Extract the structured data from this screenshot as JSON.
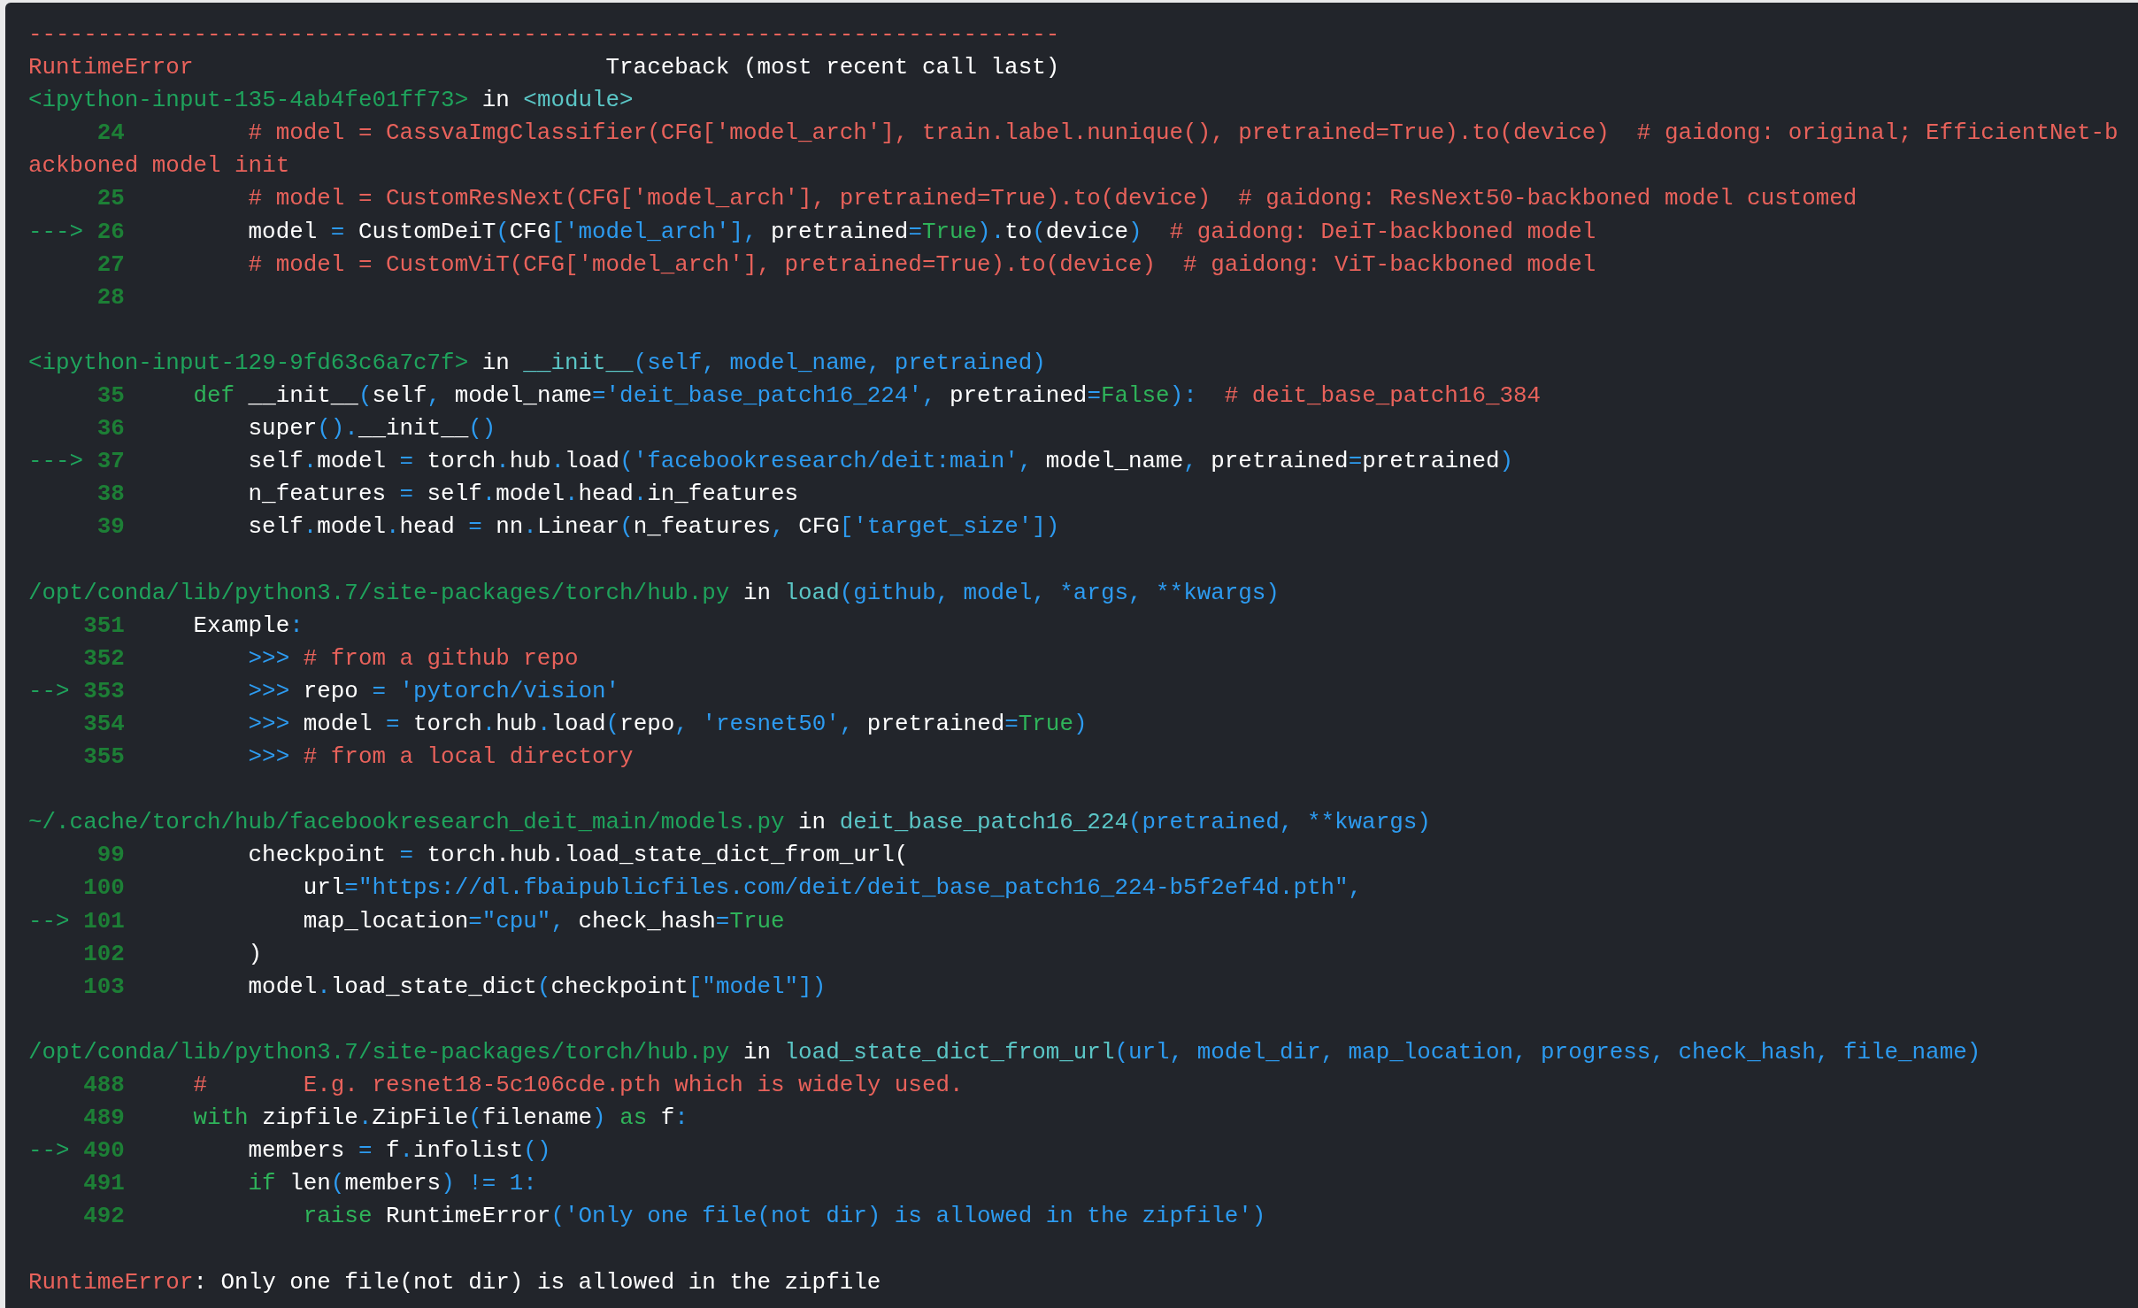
{
  "separator": "---------------------------------------------------------------------------",
  "error_type": "RuntimeError",
  "traceback_title": "Traceback (most recent call last)",
  "frames": [
    {
      "header": [
        {
          "kind": "path",
          "text": "<ipython-input-135-4ab4fe01ff73>"
        },
        {
          "kind": "plain",
          "text": " in "
        },
        {
          "kind": "func",
          "text": "<module>"
        }
      ],
      "lines": [
        {
          "number": "24",
          "code": [
            {
              "kind": "comment",
              "text": "         # model = CassvaImgClassifier(CFG['model_arch'], train.label.nunique(), pretrained=True).to(device)  # gaidong: original; EfficientNet-backboned model init"
            }
          ]
        },
        {
          "number": "25",
          "code": [
            {
              "kind": "comment",
              "text": "         # model = CustomResNext(CFG['model_arch'], pretrained=True).to(device)  # gaidong: ResNext50-backboned model customed"
            }
          ]
        },
        {
          "arrow": "--->",
          "number": "26",
          "code": [
            {
              "kind": "plain",
              "text": "         model "
            },
            {
              "kind": "op",
              "text": "= "
            },
            {
              "kind": "plain",
              "text": "CustomDeiT"
            },
            {
              "kind": "op",
              "text": "("
            },
            {
              "kind": "plain",
              "text": "CFG"
            },
            {
              "kind": "op",
              "text": "['model_arch'], "
            },
            {
              "kind": "plain",
              "text": "pretrained"
            },
            {
              "kind": "op",
              "text": "="
            },
            {
              "kind": "keyword",
              "text": "True"
            },
            {
              "kind": "op",
              "text": ")."
            },
            {
              "kind": "plain",
              "text": "to"
            },
            {
              "kind": "op",
              "text": "("
            },
            {
              "kind": "plain",
              "text": "device"
            },
            {
              "kind": "op",
              "text": ")"
            },
            {
              "kind": "comment",
              "text": "  # gaidong: DeiT-backboned model"
            }
          ]
        },
        {
          "number": "27",
          "code": [
            {
              "kind": "comment",
              "text": "         # model = CustomViT(CFG['model_arch'], pretrained=True).to(device)  # gaidong: ViT-backboned model"
            }
          ]
        },
        {
          "number": "28"
        }
      ]
    },
    {
      "header": [
        {
          "kind": "path",
          "text": "<ipython-input-129-9fd63c6a7c7f>"
        },
        {
          "kind": "plain",
          "text": " in "
        },
        {
          "kind": "func",
          "text": "__init__"
        },
        {
          "kind": "op",
          "text": "(self, model_name, pretrained)"
        }
      ],
      "lines": [
        {
          "number": "35",
          "code": [
            {
              "kind": "keyword",
              "text": "     def "
            },
            {
              "kind": "plain",
              "text": "__init__"
            },
            {
              "kind": "op",
              "text": "("
            },
            {
              "kind": "plain",
              "text": "self"
            },
            {
              "kind": "op",
              "text": ", "
            },
            {
              "kind": "plain",
              "text": "model_name"
            },
            {
              "kind": "op",
              "text": "='deit_base_patch16_224', "
            },
            {
              "kind": "plain",
              "text": "pretrained"
            },
            {
              "kind": "op",
              "text": "="
            },
            {
              "kind": "keyword",
              "text": "False"
            },
            {
              "kind": "op",
              "text": "):"
            },
            {
              "kind": "comment",
              "text": "  # deit_base_patch16_384"
            }
          ]
        },
        {
          "number": "36",
          "code": [
            {
              "kind": "plain",
              "text": "         super"
            },
            {
              "kind": "op",
              "text": "()."
            },
            {
              "kind": "plain",
              "text": "__init__"
            },
            {
              "kind": "op",
              "text": "()"
            }
          ]
        },
        {
          "arrow": "--->",
          "number": "37",
          "code": [
            {
              "kind": "plain",
              "text": "         self"
            },
            {
              "kind": "op",
              "text": "."
            },
            {
              "kind": "plain",
              "text": "model "
            },
            {
              "kind": "op",
              "text": "= "
            },
            {
              "kind": "plain",
              "text": "torch"
            },
            {
              "kind": "op",
              "text": "."
            },
            {
              "kind": "plain",
              "text": "hub"
            },
            {
              "kind": "op",
              "text": "."
            },
            {
              "kind": "plain",
              "text": "load"
            },
            {
              "kind": "op",
              "text": "('facebookresearch/deit:main', "
            },
            {
              "kind": "plain",
              "text": "model_name"
            },
            {
              "kind": "op",
              "text": ", "
            },
            {
              "kind": "plain",
              "text": "pretrained"
            },
            {
              "kind": "op",
              "text": "="
            },
            {
              "kind": "plain",
              "text": "pretrained"
            },
            {
              "kind": "op",
              "text": ")"
            }
          ]
        },
        {
          "number": "38",
          "code": [
            {
              "kind": "plain",
              "text": "         n_features "
            },
            {
              "kind": "op",
              "text": "= "
            },
            {
              "kind": "plain",
              "text": "self"
            },
            {
              "kind": "op",
              "text": "."
            },
            {
              "kind": "plain",
              "text": "model"
            },
            {
              "kind": "op",
              "text": "."
            },
            {
              "kind": "plain",
              "text": "head"
            },
            {
              "kind": "op",
              "text": "."
            },
            {
              "kind": "plain",
              "text": "in_features"
            }
          ]
        },
        {
          "number": "39",
          "code": [
            {
              "kind": "plain",
              "text": "         self"
            },
            {
              "kind": "op",
              "text": "."
            },
            {
              "kind": "plain",
              "text": "model"
            },
            {
              "kind": "op",
              "text": "."
            },
            {
              "kind": "plain",
              "text": "head "
            },
            {
              "kind": "op",
              "text": "= "
            },
            {
              "kind": "plain",
              "text": "nn"
            },
            {
              "kind": "op",
              "text": "."
            },
            {
              "kind": "plain",
              "text": "Linear"
            },
            {
              "kind": "op",
              "text": "("
            },
            {
              "kind": "plain",
              "text": "n_features"
            },
            {
              "kind": "op",
              "text": ", "
            },
            {
              "kind": "plain",
              "text": "CFG"
            },
            {
              "kind": "op",
              "text": "['target_size'])"
            }
          ]
        }
      ]
    },
    {
      "header": [
        {
          "kind": "path",
          "text": "/opt/conda/lib/python3.7/site-packages/torch/hub.py"
        },
        {
          "kind": "plain",
          "text": " in "
        },
        {
          "kind": "func",
          "text": "load"
        },
        {
          "kind": "op",
          "text": "(github, model, *args, **kwargs)"
        }
      ],
      "lines": [
        {
          "number": "351",
          "code": [
            {
              "kind": "plain",
              "text": "     Example"
            },
            {
              "kind": "op",
              "text": ":"
            }
          ]
        },
        {
          "number": "352",
          "code": [
            {
              "kind": "op",
              "text": "         >>> "
            },
            {
              "kind": "comment",
              "text": "# from a github repo"
            }
          ]
        },
        {
          "arrow": "-->",
          "number": "353",
          "code": [
            {
              "kind": "op",
              "text": "         >>> "
            },
            {
              "kind": "plain",
              "text": "repo "
            },
            {
              "kind": "op",
              "text": "= 'pytorch/vision'"
            }
          ]
        },
        {
          "number": "354",
          "code": [
            {
              "kind": "op",
              "text": "         >>> "
            },
            {
              "kind": "plain",
              "text": "model "
            },
            {
              "kind": "op",
              "text": "= "
            },
            {
              "kind": "plain",
              "text": "torch"
            },
            {
              "kind": "op",
              "text": "."
            },
            {
              "kind": "plain",
              "text": "hub"
            },
            {
              "kind": "op",
              "text": "."
            },
            {
              "kind": "plain",
              "text": "load"
            },
            {
              "kind": "op",
              "text": "("
            },
            {
              "kind": "plain",
              "text": "repo"
            },
            {
              "kind": "op",
              "text": ", 'resnet50', "
            },
            {
              "kind": "plain",
              "text": "pretrained"
            },
            {
              "kind": "op",
              "text": "="
            },
            {
              "kind": "keyword",
              "text": "True"
            },
            {
              "kind": "op",
              "text": ")"
            }
          ]
        },
        {
          "number": "355",
          "code": [
            {
              "kind": "op",
              "text": "         >>> "
            },
            {
              "kind": "comment",
              "text": "# from a local directory"
            }
          ]
        }
      ]
    },
    {
      "header": [
        {
          "kind": "path",
          "text": "~/.cache/torch/hub/facebookresearch_deit_main/models.py"
        },
        {
          "kind": "plain",
          "text": " in "
        },
        {
          "kind": "func",
          "text": "deit_base_patch16_224"
        },
        {
          "kind": "op",
          "text": "(pretrained, **kwargs)"
        }
      ],
      "lines": [
        {
          "number": "99",
          "code": [
            {
              "kind": "plain",
              "text": "         checkpoint "
            },
            {
              "kind": "op",
              "text": "= "
            },
            {
              "kind": "plain",
              "text": "torch.hub.load_state_dict_from_url("
            }
          ]
        },
        {
          "number": "100",
          "code": [
            {
              "kind": "plain",
              "text": "             url"
            },
            {
              "kind": "op",
              "text": "=\"https://dl.fbaipublicfiles.com/deit/deit_base_patch16_224-b5f2ef4d.pth\","
            }
          ]
        },
        {
          "arrow": "-->",
          "number": "101",
          "code": [
            {
              "kind": "plain",
              "text": "             map_location"
            },
            {
              "kind": "op",
              "text": "=\"cpu\", "
            },
            {
              "kind": "plain",
              "text": "check_hash"
            },
            {
              "kind": "op",
              "text": "="
            },
            {
              "kind": "keyword",
              "text": "True"
            }
          ]
        },
        {
          "number": "102",
          "code": [
            {
              "kind": "plain",
              "text": "         )"
            }
          ]
        },
        {
          "number": "103",
          "code": [
            {
              "kind": "plain",
              "text": "         model"
            },
            {
              "kind": "op",
              "text": "."
            },
            {
              "kind": "plain",
              "text": "load_state_dict"
            },
            {
              "kind": "op",
              "text": "("
            },
            {
              "kind": "plain",
              "text": "checkpoint"
            },
            {
              "kind": "op",
              "text": "[\"model\"])"
            }
          ]
        }
      ]
    },
    {
      "header": [
        {
          "kind": "path",
          "text": "/opt/conda/lib/python3.7/site-packages/torch/hub.py"
        },
        {
          "kind": "plain",
          "text": " in "
        },
        {
          "kind": "func",
          "text": "load_state_dict_from_url"
        },
        {
          "kind": "op",
          "text": "(url, model_dir, map_location, progress, check_hash, file_name)"
        }
      ],
      "lines": [
        {
          "number": "488",
          "code": [
            {
              "kind": "comment",
              "text": "     #       E.g. resnet18-5c106cde.pth which is widely used."
            }
          ]
        },
        {
          "number": "489",
          "code": [
            {
              "kind": "keyword",
              "text": "     with "
            },
            {
              "kind": "plain",
              "text": "zipfile"
            },
            {
              "kind": "op",
              "text": "."
            },
            {
              "kind": "plain",
              "text": "ZipFile"
            },
            {
              "kind": "op",
              "text": "("
            },
            {
              "kind": "plain",
              "text": "filename"
            },
            {
              "kind": "op",
              "text": ") "
            },
            {
              "kind": "keyword",
              "text": "as "
            },
            {
              "kind": "plain",
              "text": "f"
            },
            {
              "kind": "op",
              "text": ":"
            }
          ]
        },
        {
          "arrow": "-->",
          "number": "490",
          "code": [
            {
              "kind": "plain",
              "text": "         members "
            },
            {
              "kind": "op",
              "text": "= "
            },
            {
              "kind": "plain",
              "text": "f"
            },
            {
              "kind": "op",
              "text": "."
            },
            {
              "kind": "plain",
              "text": "infolist"
            },
            {
              "kind": "op",
              "text": "()"
            }
          ]
        },
        {
          "number": "491",
          "code": [
            {
              "kind": "keyword",
              "text": "         if "
            },
            {
              "kind": "plain",
              "text": "len"
            },
            {
              "kind": "op",
              "text": "("
            },
            {
              "kind": "plain",
              "text": "members"
            },
            {
              "kind": "op",
              "text": ") != 1:"
            }
          ]
        },
        {
          "number": "492",
          "code": [
            {
              "kind": "keyword",
              "text": "             raise "
            },
            {
              "kind": "plain",
              "text": "RuntimeError"
            },
            {
              "kind": "op",
              "text": "('Only one file(not dir) is allowed in the zipfile')"
            }
          ]
        }
      ]
    }
  ],
  "final_error": {
    "type": "RuntimeError",
    "message": ": Only one file(not dir) is allowed in the zipfile"
  }
}
